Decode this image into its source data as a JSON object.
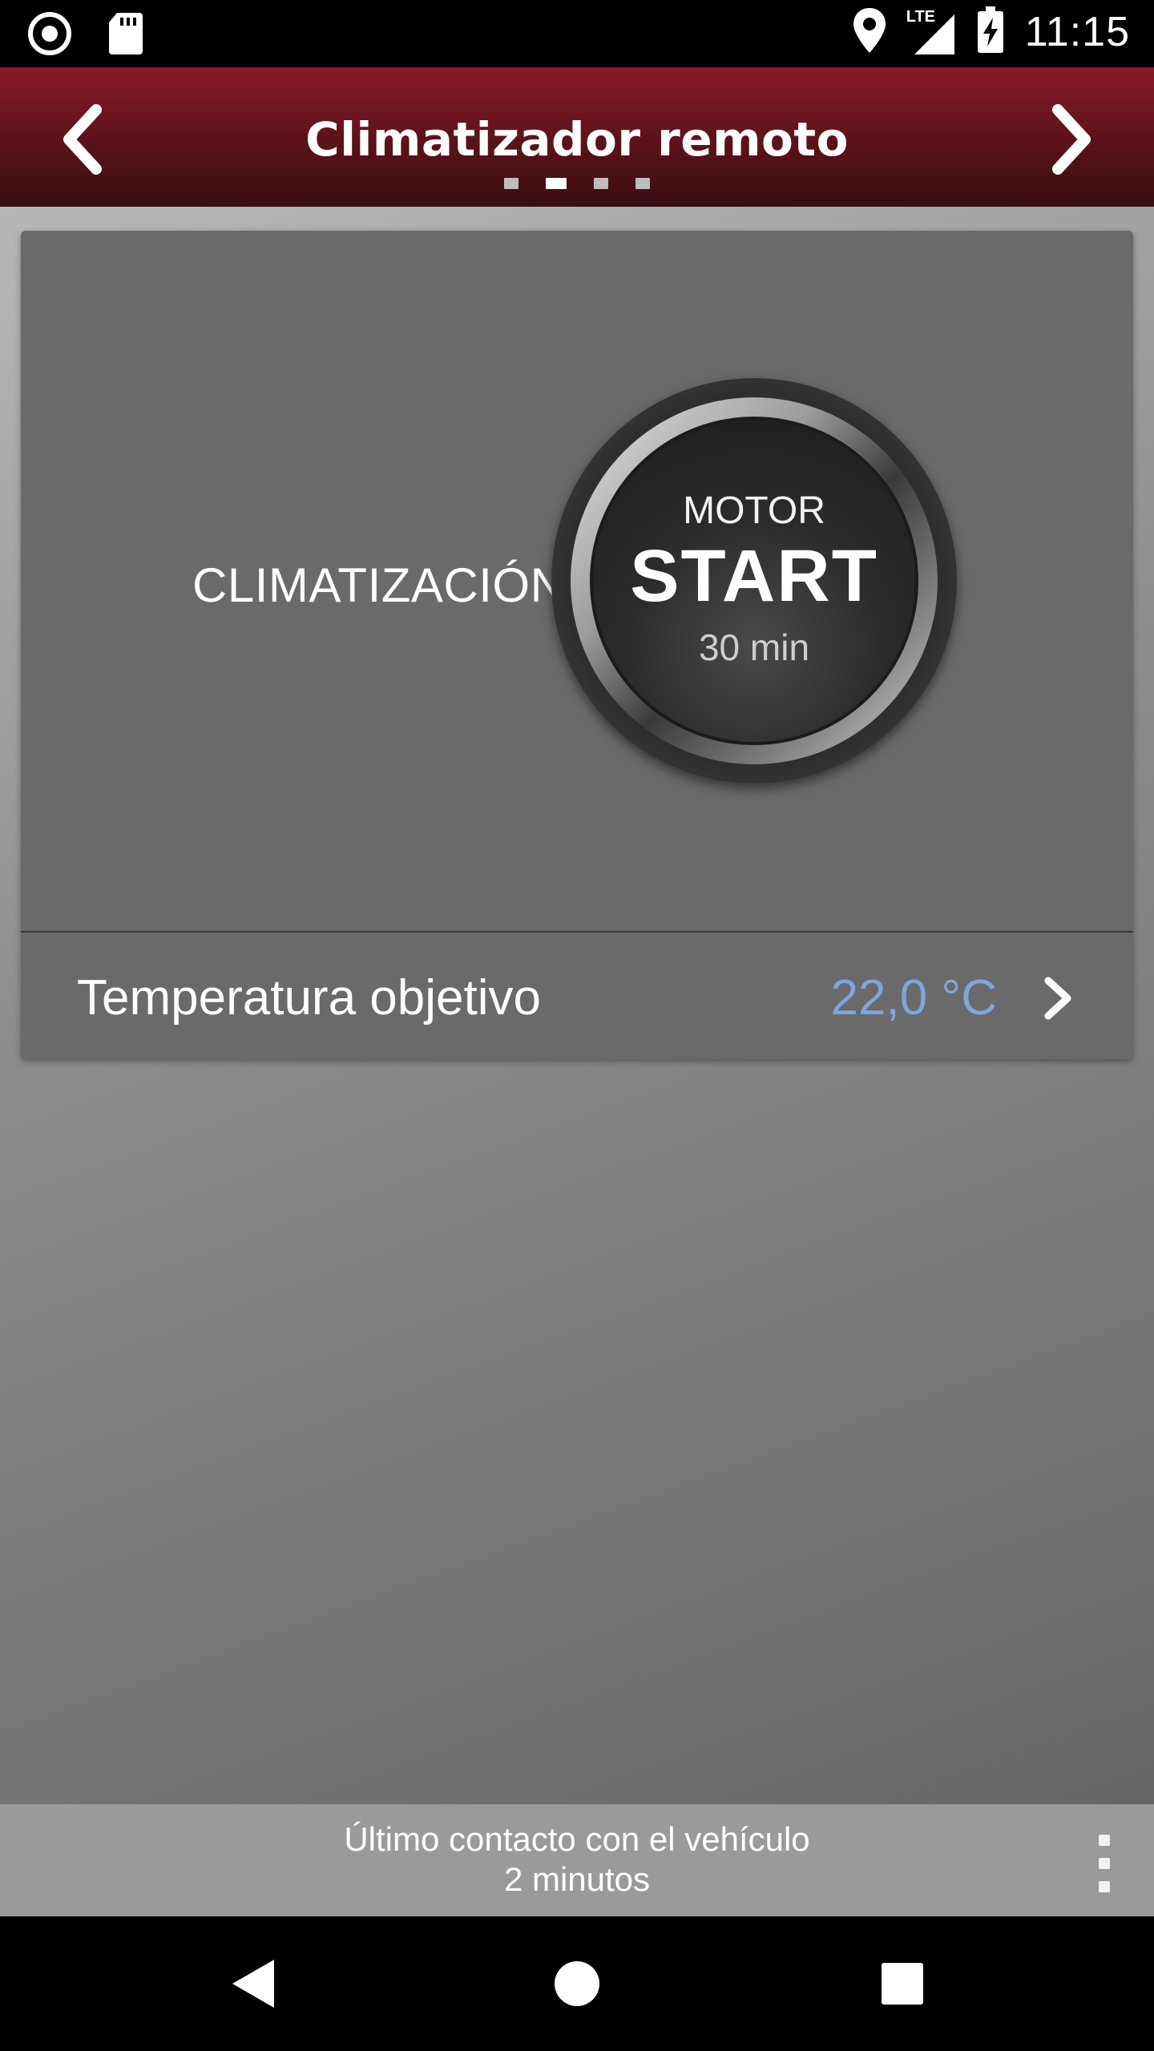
{
  "status_bar": {
    "time": "11:15",
    "network": "LTE",
    "icons": [
      "record-icon",
      "sd-card-icon",
      "location-icon",
      "signal-icon",
      "battery-charging-icon"
    ]
  },
  "header": {
    "title": "Climatizador remoto",
    "prev_icon": "chevron-left-icon",
    "next_icon": "chevron-right-icon",
    "page_count": 4,
    "active_page_index": 1
  },
  "climate": {
    "label": "CLIMATIZACIÓN",
    "start_button": {
      "top_text": "MOTOR",
      "main_text": "START",
      "duration": "30 min"
    }
  },
  "temperature": {
    "label": "Temperatura objetivo",
    "value": "22,0 °C",
    "value_color": "#7ea6d8"
  },
  "info_bar": {
    "line1": "Último contacto con el vehículo",
    "line2": "2 minutos"
  },
  "colors": {
    "header_top": "#8a1a26",
    "header_bottom": "#3a0c11",
    "card_bg": "#6a6a6a"
  }
}
